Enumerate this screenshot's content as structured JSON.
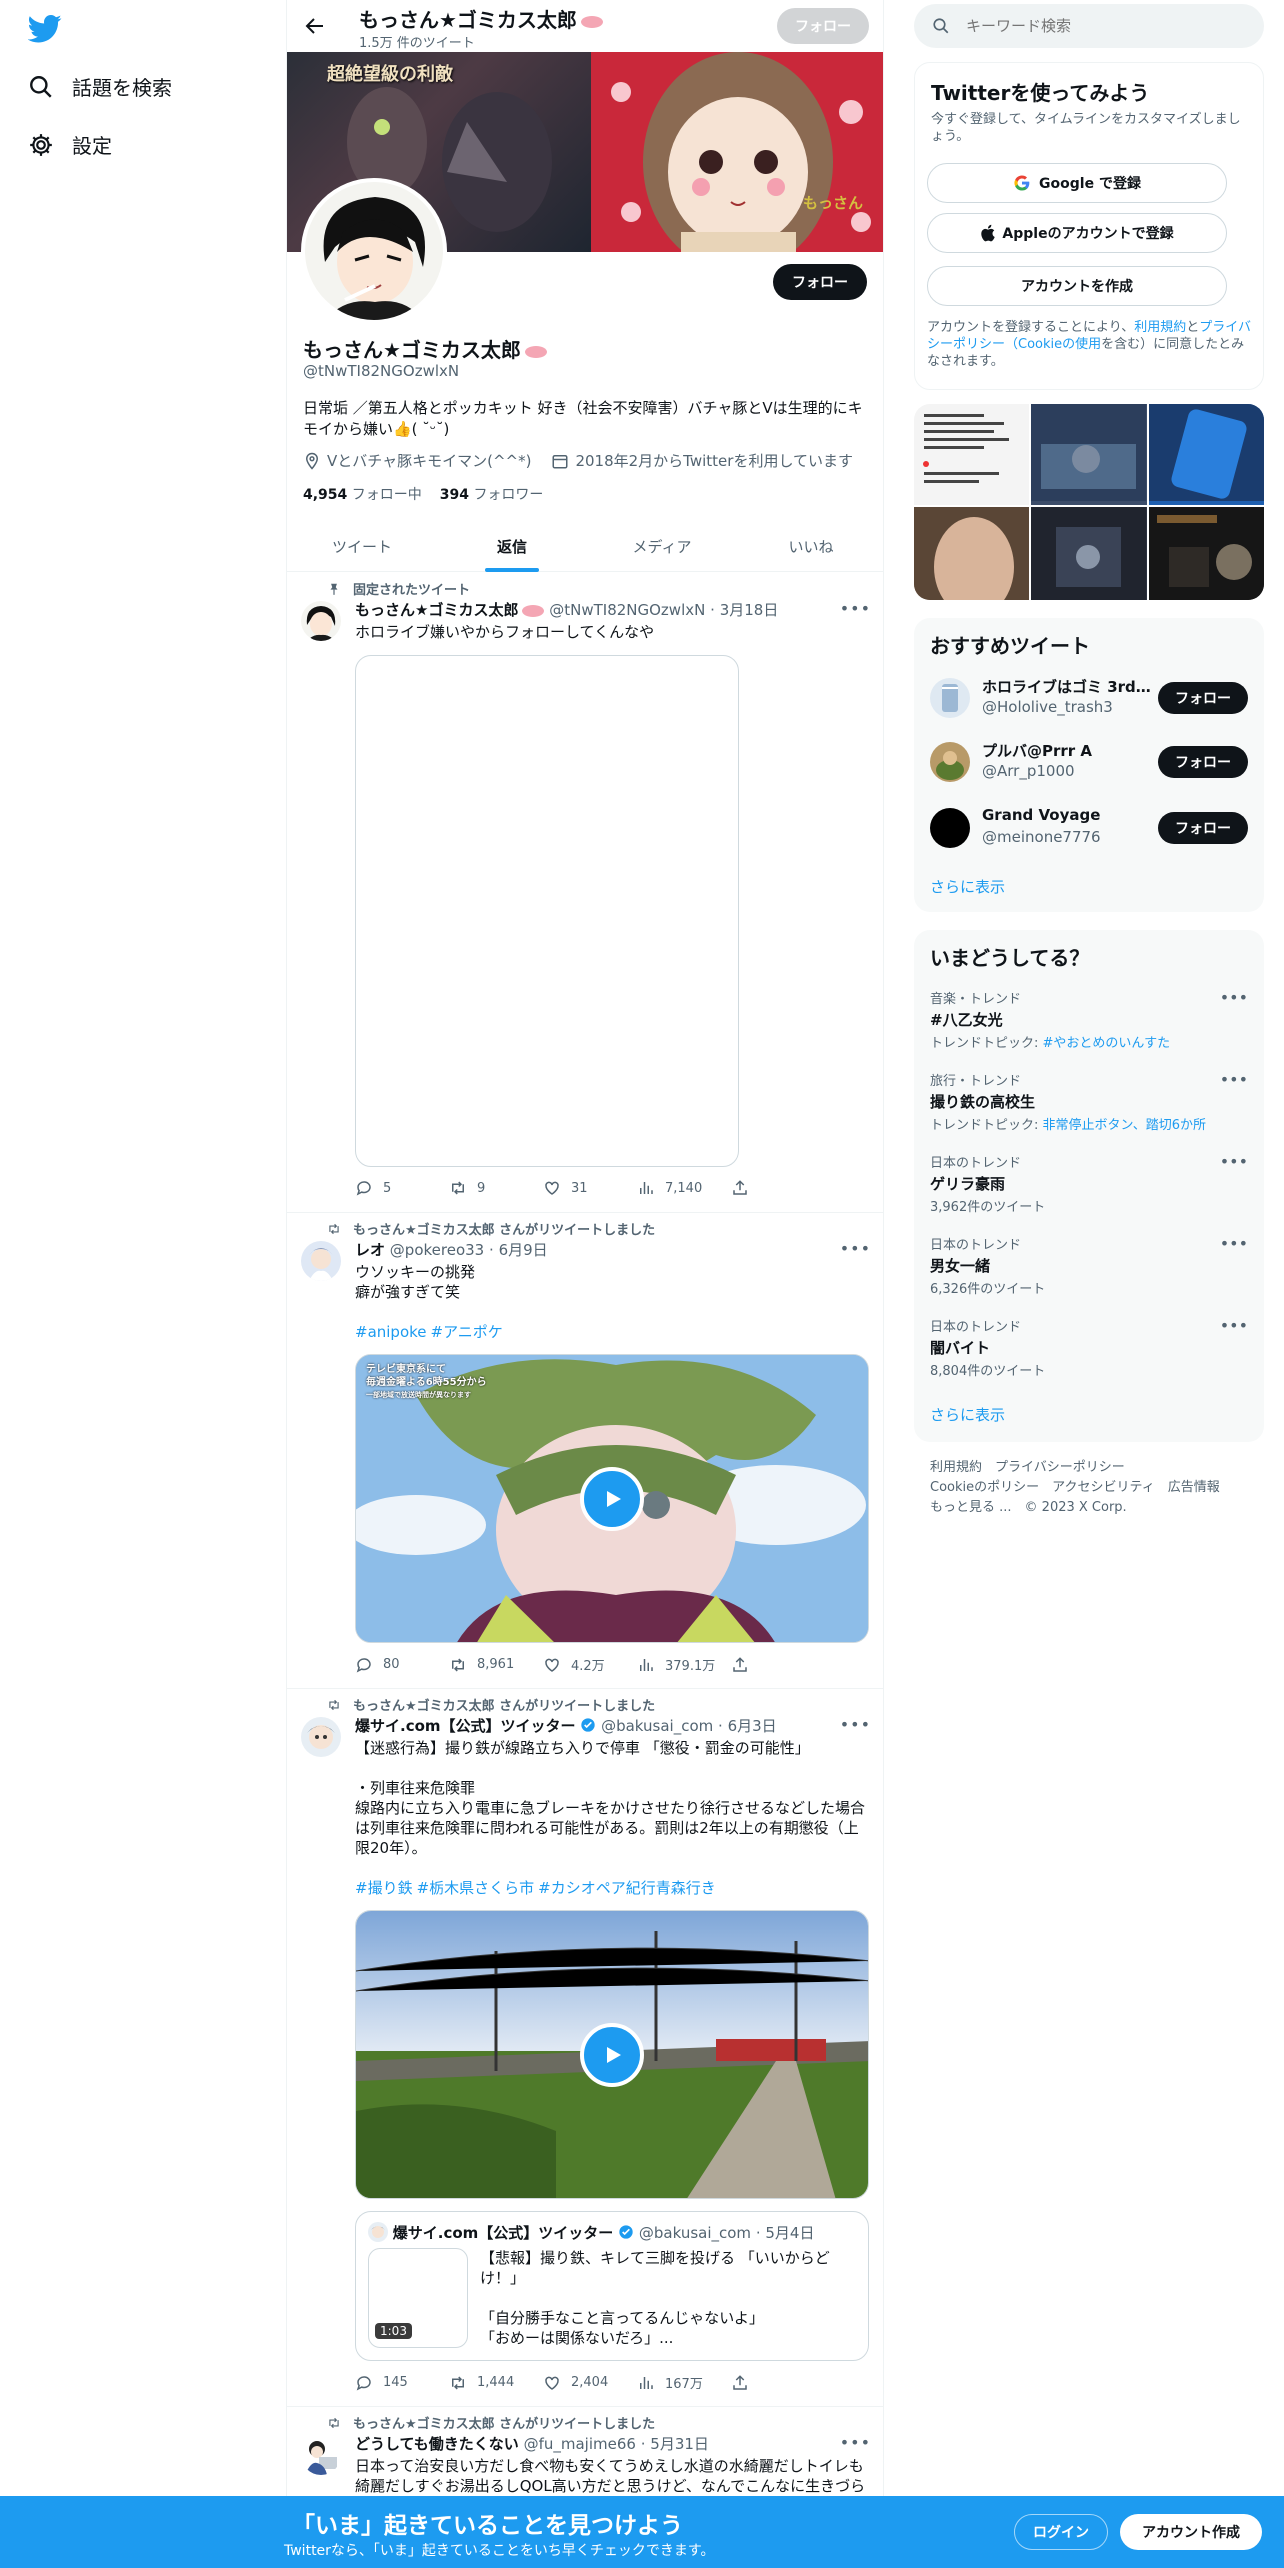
{
  "nav": {
    "explore_label": "話題を検索",
    "settings_label": "設定"
  },
  "header": {
    "name": "もっさん★ゴミカス太郎",
    "tweet_count": "1.5万 件のツイート",
    "follow_label": "フォロー"
  },
  "banner": {
    "overlay_text": "超絶望級の利敵",
    "sticker_text": "もっさん"
  },
  "profile": {
    "name": "もっさん★ゴミカス太郎",
    "handle": "@tNwTI82NGOzwlxN",
    "bio": "日常垢 ／第五人格とポッカキット 好き（社会不安障害）バチャ豚とVは生理的にキモイから嫌い👍( ˘ᵕ˘)",
    "location": "Vとバチャ豚キモイマン(^^*)",
    "joined": "2018年2月からTwitterを利用しています",
    "following_count": "4,954",
    "following_label": "フォロー中",
    "followers_count": "394",
    "followers_label": "フォロワー",
    "follow_label": "フォロー"
  },
  "tabs": [
    {
      "label": "ツイート"
    },
    {
      "label": "返信"
    },
    {
      "label": "メディア"
    },
    {
      "label": "いいね"
    }
  ],
  "tweets": [
    {
      "context": "固定されたツイート",
      "name": "もっさん★ゴミカス太郎",
      "handle": "@tNwTI82NGOzwlxN",
      "date": "3月18日",
      "text": "ホロライブ嫌いやからフォローしてくんなや",
      "replies": "5",
      "retweets": "9",
      "likes": "31",
      "views": "7,140"
    },
    {
      "context": "もっさん★ゴミカス太郎 さんがリツイートしました",
      "name": "レオ",
      "handle": "@pokereo33",
      "date": "6月9日",
      "text1": "ウソッキーの挑発",
      "text2": "癖が強すぎて笑",
      "tags": [
        "#anipoke",
        "#アニポケ"
      ],
      "video_caption1": "テレビ東京系にて",
      "video_caption2": "毎週金曜よる6時55分から",
      "video_caption3": "一部地域で放送時間が異なります",
      "replies": "80",
      "retweets": "8,961",
      "likes": "4.2万",
      "views": "379.1万"
    },
    {
      "context": "もっさん★ゴミカス太郎 さんがリツイートしました",
      "name": "爆サイ.com【公式】ツイッター",
      "handle": "@bakusai_com",
      "date": "6月3日",
      "text1": "【迷惑行為】撮り鉄が線路立ち入りで停車 「懲役・罰金の可能性」",
      "text2": "・列車往来危険罪",
      "text3": "線路内に立ち入り電車に急ブレーキをかけさせたり徐行させるなどした場合は列車往来危険罪に問われる可能性がある。罰則は2年以上の有期懲役（上限20年）。",
      "tags": [
        "#撮り鉄",
        "#栃木県さくら市",
        "#カシオペア紀行青森行き"
      ],
      "quote": {
        "name": "爆サイ.com【公式】ツイッター",
        "handle": "@bakusai_com",
        "date": "5月4日",
        "duration": "1:03",
        "line1": "【悲報】撮り鉄、キレて三脚を投げる 「いいからどけ！」",
        "line2": "「自分勝手なこと言ってるんじゃないよ」",
        "line3": "「おめーは関係ないだろ」..."
      },
      "replies": "145",
      "retweets": "1,444",
      "likes": "2,404",
      "views": "167万"
    },
    {
      "context": "もっさん★ゴミカス太郎 さんがリツイートしました",
      "name": "どうしても働きたくない",
      "handle": "@fu_majime66",
      "date": "5月31日",
      "text": "日本って治安良い方だし食べ物も安くてうめえし水道の水綺麗だしトイレも綺麗だしすぐお湯出るしQOL高い方だと思うけど、なんでこんなに生きづら"
    }
  ],
  "search": {
    "placeholder": "キーワード検索"
  },
  "signup": {
    "title": "Twitterを使ってみよう",
    "subtitle": "今すぐ登録して、タイムラインをカスタマイズしましょう。",
    "google_label": "Google で登録",
    "apple_label": "Appleのアカウントで登録",
    "create_label": "アカウントを作成",
    "legal_prefix": "アカウントを登録することにより、",
    "terms_link": "利用規約",
    "and1": "と",
    "privacy_link": "プライバシーポリシー",
    "cookie_link": "（Cookieの使用",
    "legal_suffix": "を含む）に同意したとみなされます。"
  },
  "recommend": {
    "title": "おすすめツイート",
    "users": [
      {
        "name": "ホロライブはゴミ 3rd...",
        "handle": "@Hololive_trash3",
        "follow": "フォロー"
      },
      {
        "name": "プルバ@Prrr A",
        "handle": "@Arr_p1000",
        "follow": "フォロー"
      },
      {
        "name": "Grand Voyage",
        "handle": "@meinone7776",
        "follow": "フォロー"
      }
    ],
    "more": "さらに表示"
  },
  "trends": {
    "title": "いまどうしてる？",
    "items": [
      {
        "cat": "音楽・トレンド",
        "name": "#八乙女光",
        "sub_prefix": "トレンドトピック: ",
        "sub_link": "#やおとめのいんすた"
      },
      {
        "cat": "旅行・トレンド",
        "name": "撮り鉄の高校生",
        "sub_prefix": "トレンドトピック: ",
        "sub_link": "非常停止ボタン、踏切6か所"
      },
      {
        "cat": "日本のトレンド",
        "name": "ゲリラ豪雨",
        "sub_prefix": "3,962件のツイート",
        "sub_link": ""
      },
      {
        "cat": "日本のトレンド",
        "name": "男女一緒",
        "sub_prefix": "6,326件のツイート",
        "sub_link": ""
      },
      {
        "cat": "日本のトレンド",
        "name": "闇バイト",
        "sub_prefix": "8,804件のツイート",
        "sub_link": ""
      }
    ],
    "more": "さらに表示"
  },
  "footer": {
    "terms": "利用規約",
    "privacy": "プライバシーポリシー",
    "cookie": "Cookieのポリシー",
    "access": "アクセシビリティ",
    "ads": "広告情報",
    "more": "もっと見る ...",
    "copyright": "© 2023 X Corp."
  },
  "bottombar": {
    "title": "「いま」起きていることを見つけよう",
    "subtitle": "Twitterなら、「いま」起きていることをいち早くチェックできます。",
    "login": "ログイン",
    "signup": "アカウント作成"
  },
  "colors": {
    "accent": "#1d9bf0",
    "text": "#0f1419",
    "muted": "#536471"
  }
}
